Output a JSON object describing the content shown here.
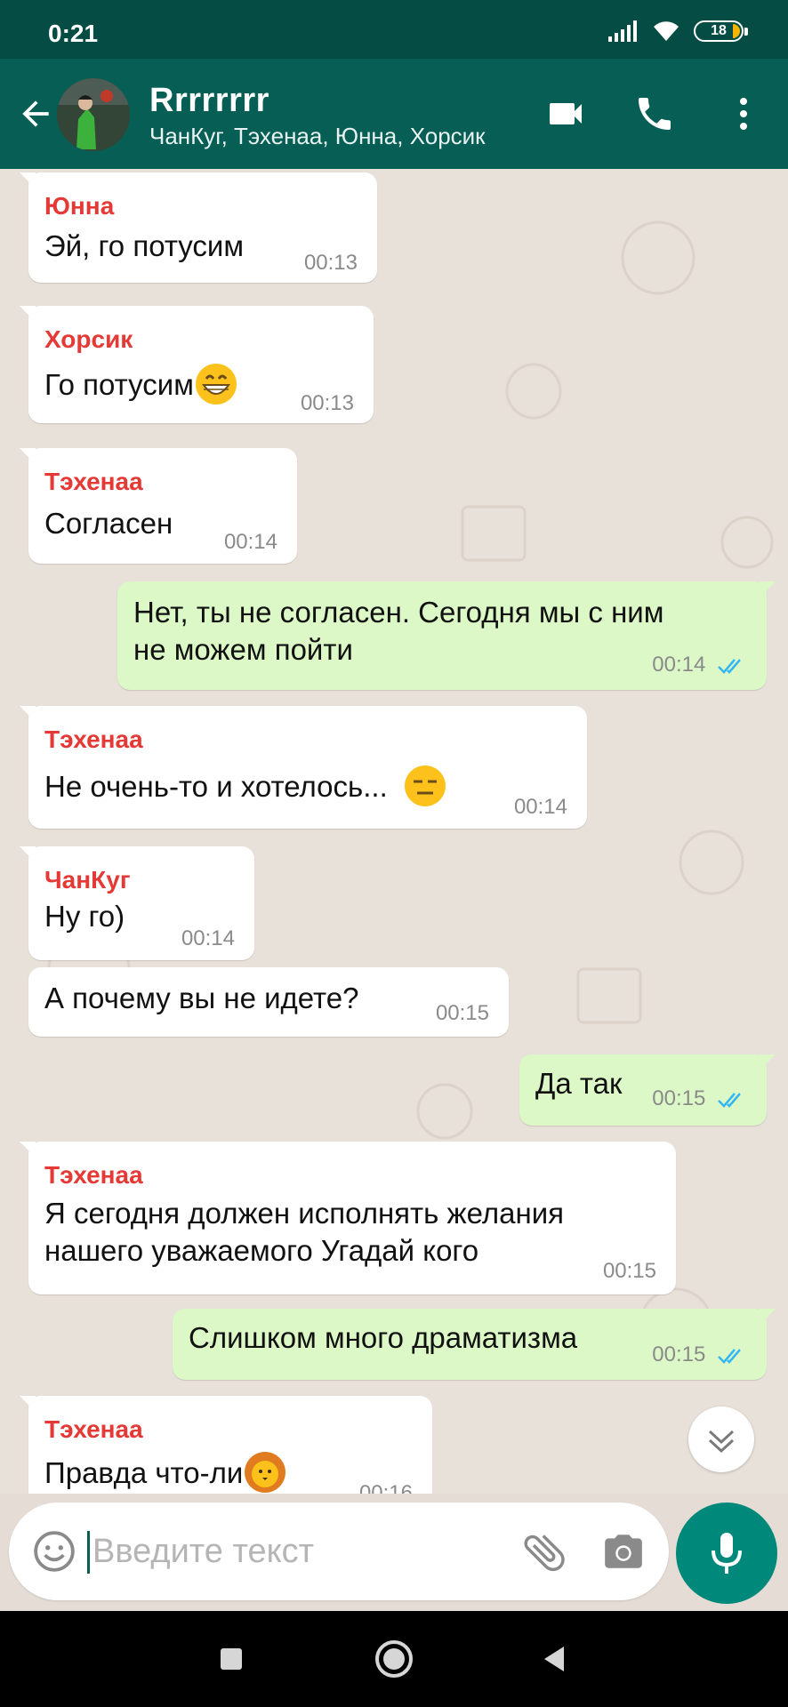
{
  "status_bar": {
    "time": "0:21",
    "battery": "18"
  },
  "header": {
    "title": "Rrrrrrrr",
    "members": "ЧанКуг, Тэхенаа, Юнна, Хорсик"
  },
  "messages": [
    {
      "sender": "Юнна",
      "sender_color": "#e53935",
      "text": "Эй, го потусим",
      "time": "00:13",
      "direction": "in"
    },
    {
      "sender": "Хорсик",
      "sender_color": "#e53935",
      "text": "Го потусим",
      "emoji": "grinning-face",
      "time": "00:13",
      "direction": "in"
    },
    {
      "sender": "Тэхенаа",
      "sender_color": "#e53935",
      "text": "Согласен",
      "time": "00:14",
      "direction": "in"
    },
    {
      "text_line1": "Нет, ты не согласен. Сегодня мы с ним",
      "text_line2": "не можем пойти",
      "time": "00:14",
      "direction": "out"
    },
    {
      "sender": "Тэхенаа",
      "sender_color": "#e53935",
      "text": "Не очень-то и хотелось...",
      "emoji": "expressionless-face",
      "time": "00:14",
      "direction": "in"
    },
    {
      "sender": "ЧанКуг",
      "sender_color": "#e53935",
      "text": "Ну го)",
      "time": "00:14",
      "direction": "in"
    },
    {
      "text": "А почему вы не идете?",
      "time": "00:15",
      "direction": "in"
    },
    {
      "text": "Да так",
      "time": "00:15",
      "direction": "out"
    },
    {
      "sender": "Тэхенаа",
      "sender_color": "#e53935",
      "text_line1": "Я сегодня должен исполнять желания",
      "text_line2": "нашего уважаемого Угадай кого",
      "time": "00:15",
      "direction": "in"
    },
    {
      "text": "Слишком много драматизма",
      "time": "00:15",
      "direction": "out"
    },
    {
      "sender": "Тэхенаа",
      "sender_color": "#e53935",
      "text": "Правда что-ли",
      "emoji": "lion-face",
      "time": "00:16",
      "direction": "in"
    }
  ],
  "input": {
    "placeholder": "Введите текст"
  },
  "colors": {
    "header": "#075e54",
    "status_bar": "#054d44",
    "accent": "#00897b",
    "outgoing_bubble": "#dcf8c6",
    "ticks": "#34b7f1"
  },
  "icons": [
    "back-arrow-icon",
    "video-call-icon",
    "phone-icon",
    "more-vert-icon",
    "emoji-icon",
    "attach-icon",
    "camera-icon",
    "mic-icon",
    "chevron-down-icon",
    "nav-recents-icon",
    "nav-home-icon",
    "nav-back-icon"
  ]
}
